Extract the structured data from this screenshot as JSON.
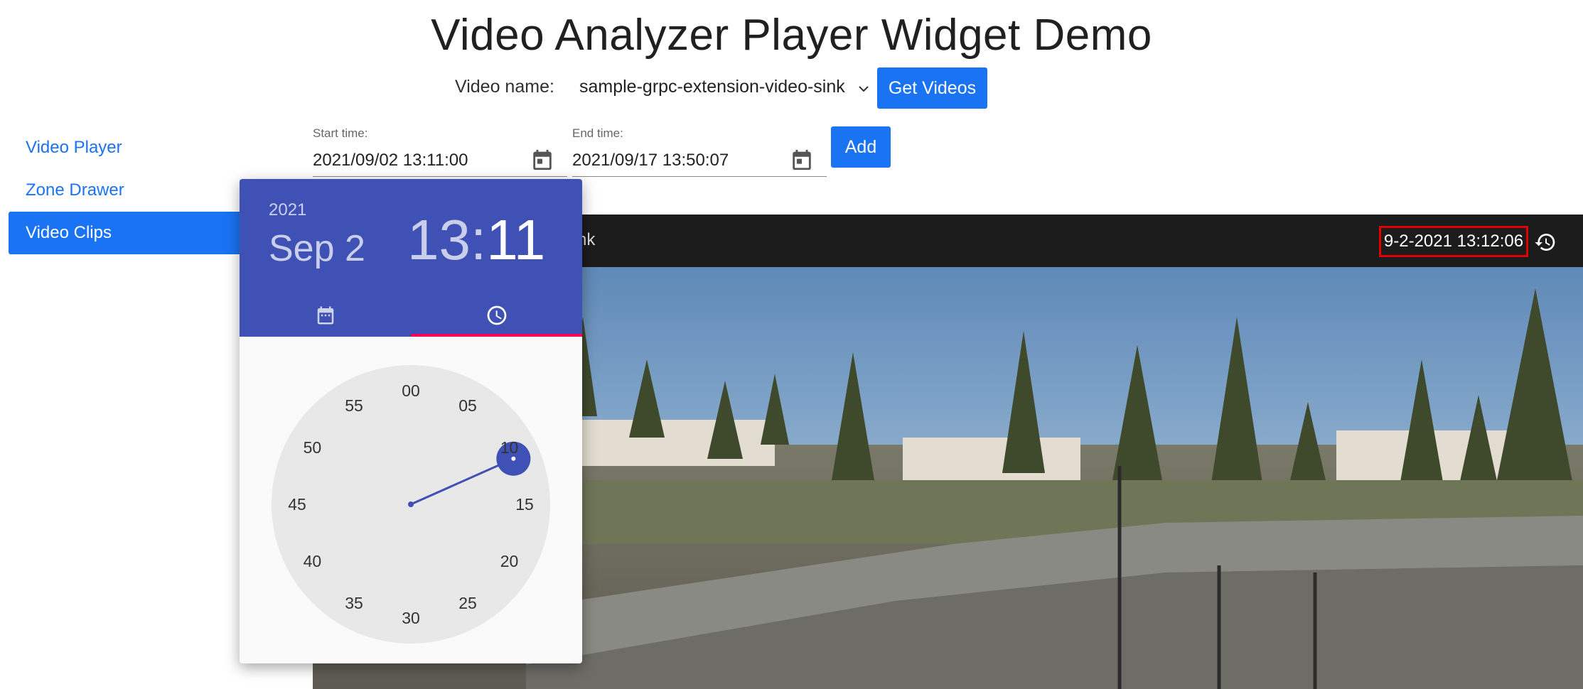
{
  "page": {
    "title": "Video Analyzer Player Widget Demo"
  },
  "video_name": {
    "label": "Video name:",
    "selected": "sample-grpc-extension-video-sink",
    "get_videos_label": "Get Videos"
  },
  "sidebar": {
    "items": [
      {
        "label": "Video Player"
      },
      {
        "label": "Zone Drawer"
      },
      {
        "label": "Video Clips"
      }
    ]
  },
  "start_time": {
    "label": "Start time:",
    "value": "2021/09/02 13:11:00"
  },
  "end_time": {
    "label": "End time:",
    "value": "2021/09/17 13:50:07"
  },
  "add_label": "Add",
  "player": {
    "title_fragment": "nk",
    "timestamp": "9-2-2021 13:12:06"
  },
  "picker": {
    "year": "2021",
    "date": "Sep 2",
    "hours": "13",
    "separator": ":",
    "minutes": "11",
    "active_tab": "time",
    "selected_minute": 11,
    "clock_numbers": [
      "00",
      "05",
      "10",
      "15",
      "20",
      "25",
      "30",
      "35",
      "40",
      "45",
      "50",
      "55"
    ]
  },
  "colors": {
    "accent": "#1a73f2",
    "picker_header": "#3f51b5",
    "tab_indicator": "#f50057",
    "highlight_box": "#e00000"
  }
}
